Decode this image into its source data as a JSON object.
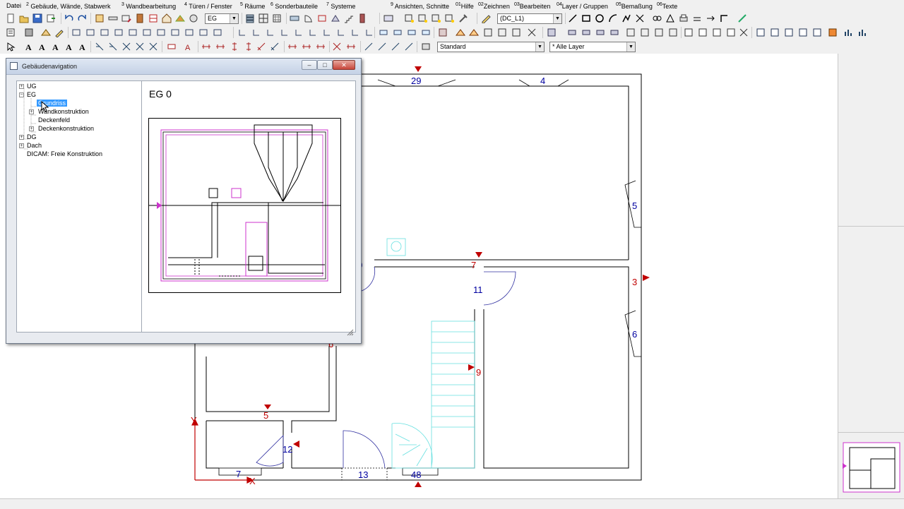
{
  "menu": {
    "items": [
      {
        "label": "Datei"
      },
      {
        "num": "2",
        "label": "Gebäude, Wände, Stabwerk"
      },
      {
        "num": "3",
        "label": "Wandbearbeitung"
      },
      {
        "num": "4",
        "label": "Türen / Fenster"
      },
      {
        "num": "5",
        "label": "Räume"
      },
      {
        "num": "6",
        "label": "Sonderbauteile"
      },
      {
        "num": "7",
        "label": "Systeme"
      },
      {
        "num": "9",
        "label": "Ansichten, Schnitte"
      },
      {
        "num": "01",
        "label": "Hilfe"
      },
      {
        "num": "02",
        "label": "Zeichnen"
      },
      {
        "num": "03",
        "label": "Bearbeiten"
      },
      {
        "num": "04",
        "label": "Layer / Gruppen"
      },
      {
        "num": "05",
        "label": "Bemaßung"
      },
      {
        "num": "06",
        "label": "Texte"
      }
    ]
  },
  "toolbar": {
    "floor_select": "EG",
    "layer_select": "(DC_L1)",
    "style_select": "Standard",
    "layer_filter_select": "* Alle Layer"
  },
  "dialog": {
    "title": "Gebäudenavigation",
    "preview_title": "EG 0",
    "tree": [
      {
        "label": "UG",
        "expander": "+"
      },
      {
        "label": "EG",
        "expander": "−"
      },
      {
        "label": "Grundriss",
        "selected": true
      },
      {
        "label": "Wandkonstruktion",
        "expander": "+"
      },
      {
        "label": "Deckenfeld"
      },
      {
        "label": "Deckenkonstruktion",
        "expander": "+"
      },
      {
        "label": "DG",
        "expander": "+"
      },
      {
        "label": "Dach",
        "expander": "+"
      },
      {
        "label": "DICAM: Freie Konstruktion"
      }
    ]
  },
  "drawing": {
    "opening_labels": [
      "29",
      "4",
      "5",
      "3",
      "6",
      "11",
      "7",
      "0",
      "9",
      "6",
      "5",
      "12",
      "7",
      "13",
      "48"
    ],
    "axis_labels": {
      "x": "X",
      "y": "Y"
    }
  },
  "colors": {
    "wall": "#000000",
    "opening_label": "#0000a0",
    "marker": "#c00000",
    "stairs": "#66e0e0",
    "outline_magenta": "#cc33cc",
    "selection": "#3399ff"
  }
}
